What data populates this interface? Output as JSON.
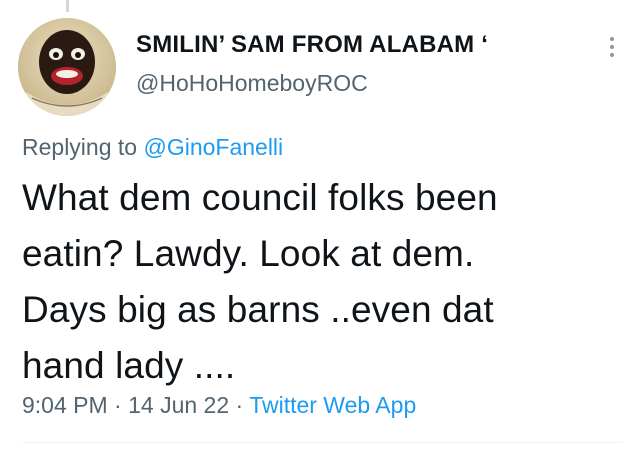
{
  "tweet": {
    "author": {
      "display_name": "SMILIN’ SAM FROM ALABAM ‘",
      "handle": "@HoHoHomeboyROC",
      "avatar": "avatar-image"
    },
    "more_icon": "more-vertical-icon",
    "reply_context": {
      "prefix": "Replying to",
      "mention": "@GinoFanelli"
    },
    "text_lines": [
      "What dem council folks been",
      "eatin? Lawdy. Look at dem.",
      "Days big as barns ..even dat",
      "hand lady ...."
    ],
    "meta": {
      "time": "9:04 PM",
      "separator": "·",
      "date": "14 Jun 22",
      "source": "Twitter Web App"
    }
  },
  "colors": {
    "text": "#0f1419",
    "secondary": "#536471",
    "link": "#1d9bf0",
    "divider": "#eff3f4"
  }
}
